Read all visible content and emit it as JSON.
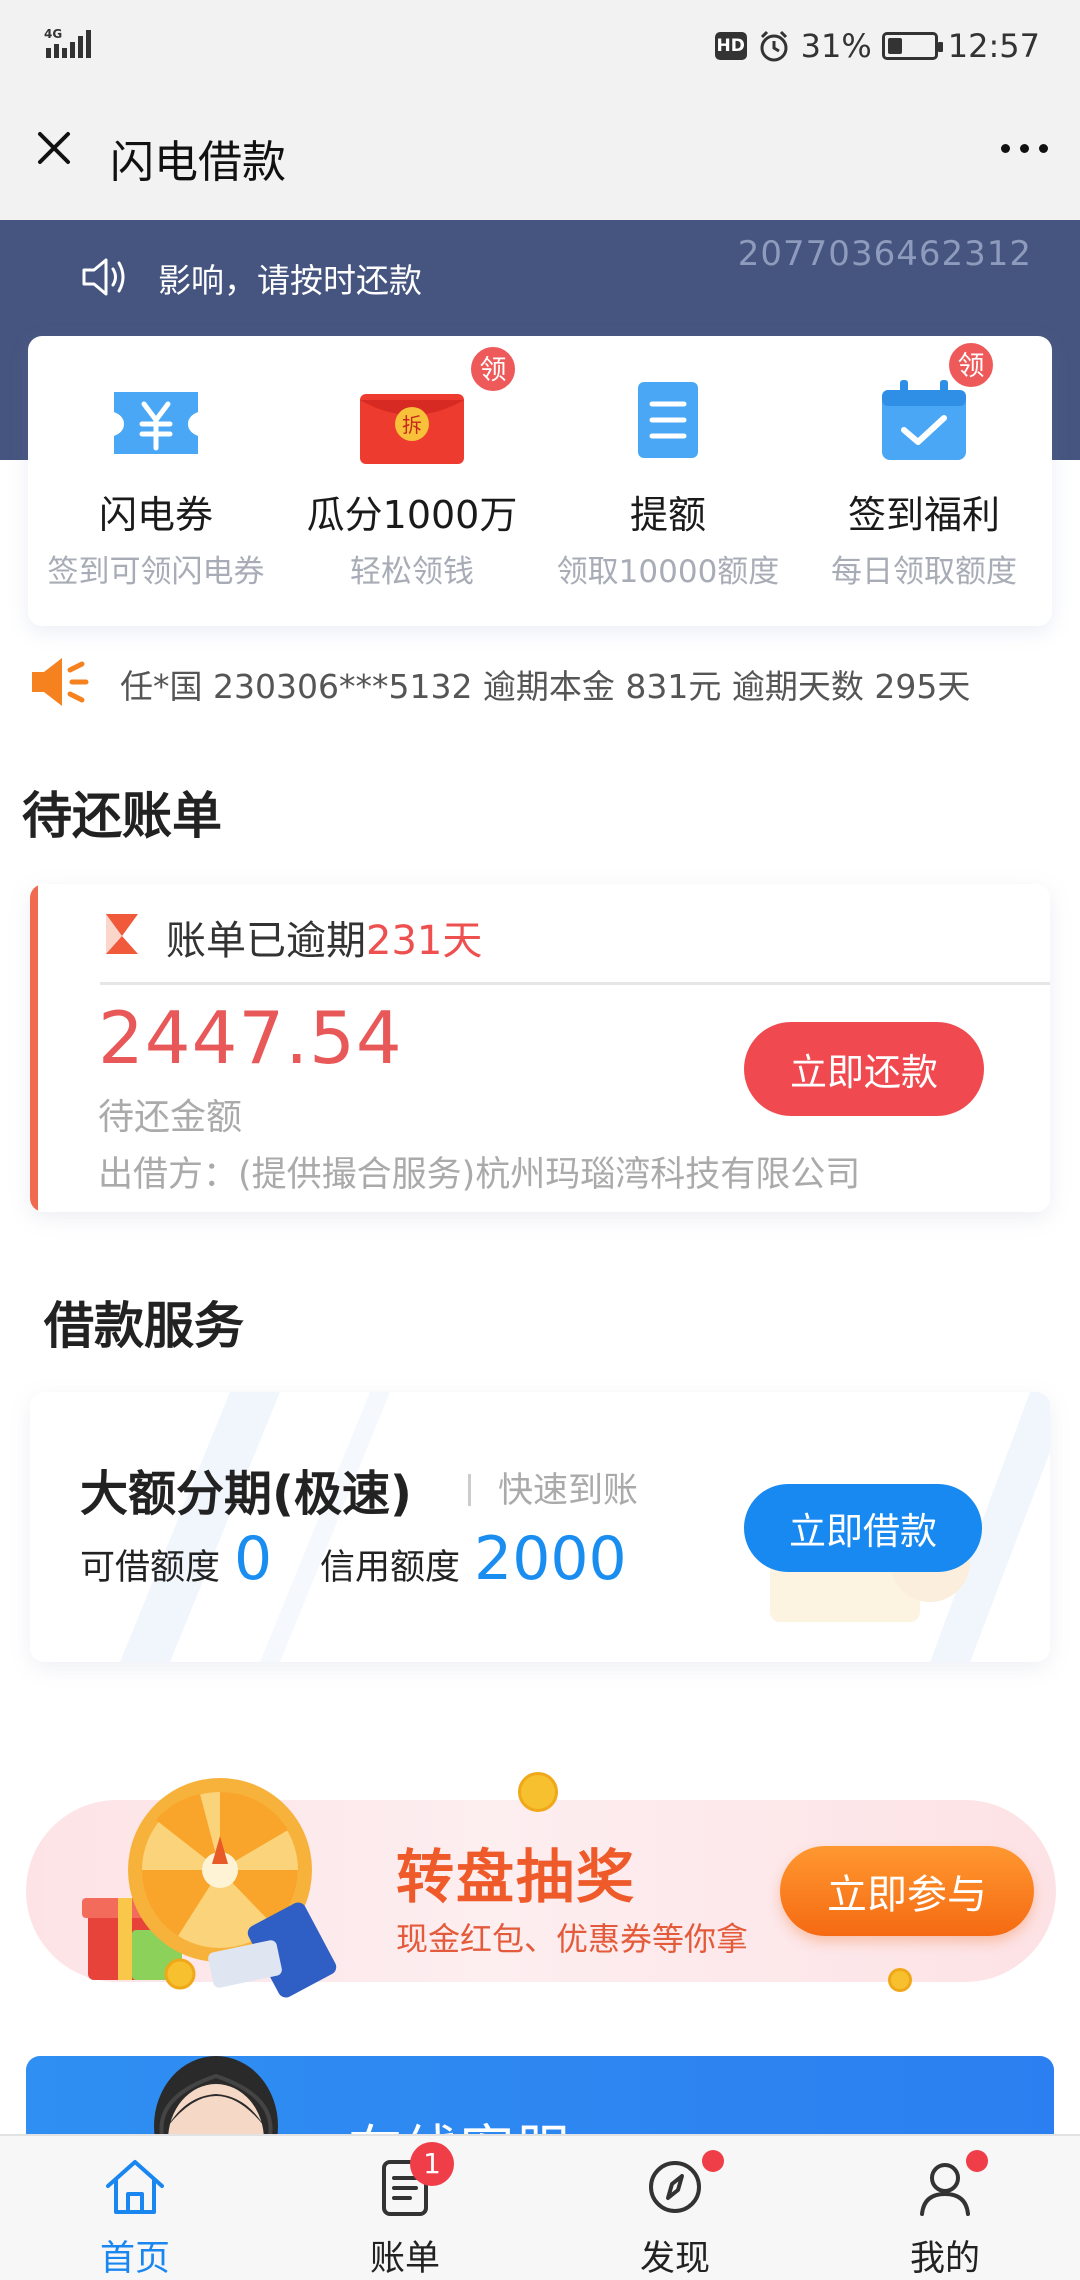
{
  "status_bar": {
    "network": "4G",
    "hd": "HD",
    "battery_percent": "31%",
    "battery_level": 0.31,
    "time": "12:57"
  },
  "nav": {
    "title": "闪电借款"
  },
  "header": {
    "notice": "影响，请按时还款",
    "number": "2077036462312"
  },
  "quick_actions": [
    {
      "title": "闪电券",
      "subtitle": "签到可领闪电券",
      "icon": "ticket-icon",
      "badge": ""
    },
    {
      "title": "瓜分1000万",
      "subtitle": "轻松领钱",
      "icon": "red-envelope-icon",
      "badge": "领",
      "envelope_text": "拆"
    },
    {
      "title": "提额",
      "subtitle": "领取10000额度",
      "icon": "document-icon",
      "badge": ""
    },
    {
      "title": "签到福利",
      "subtitle": "每日领取额度",
      "icon": "calendar-check-icon",
      "badge": "领"
    }
  ],
  "marquee": {
    "text": "任*国 230306***5132 逾期本金 831元 逾期天数 295天"
  },
  "pending_bills": {
    "section_title": "待还账单",
    "status_prefix": "账单已逾期",
    "overdue_days": "231天",
    "amount": "2447.54",
    "amount_label": "待还金额",
    "lender": "出借方：(提供撮合服务)杭州玛瑙湾科技有限公司",
    "repay_button": "立即还款"
  },
  "loan_service": {
    "section_title": "借款服务",
    "product_name": "大额分期(极速)",
    "product_tag": "快速到账",
    "available_label": "可借额度",
    "available_value": "0",
    "credit_label": "信用额度",
    "credit_value": "2000",
    "borrow_button": "立即借款"
  },
  "lottery": {
    "title": "转盘抽奖",
    "subtitle": "现金红包、优惠券等你拿",
    "button": "立即参与"
  },
  "service": {
    "title": "在线客服"
  },
  "tabs": [
    {
      "label": "首页",
      "icon": "home-icon",
      "active": true,
      "badge": ""
    },
    {
      "label": "账单",
      "icon": "bill-icon",
      "active": false,
      "badge": "1"
    },
    {
      "label": "发现",
      "icon": "compass-icon",
      "active": false,
      "badge": "dot"
    },
    {
      "label": "我的",
      "icon": "user-icon",
      "active": false,
      "badge": "dot"
    }
  ],
  "colors": {
    "header_band": "#46557f",
    "accent_blue": "#1789f0",
    "accent_red": "#f04a50",
    "accent_orange": "#f56a12"
  }
}
